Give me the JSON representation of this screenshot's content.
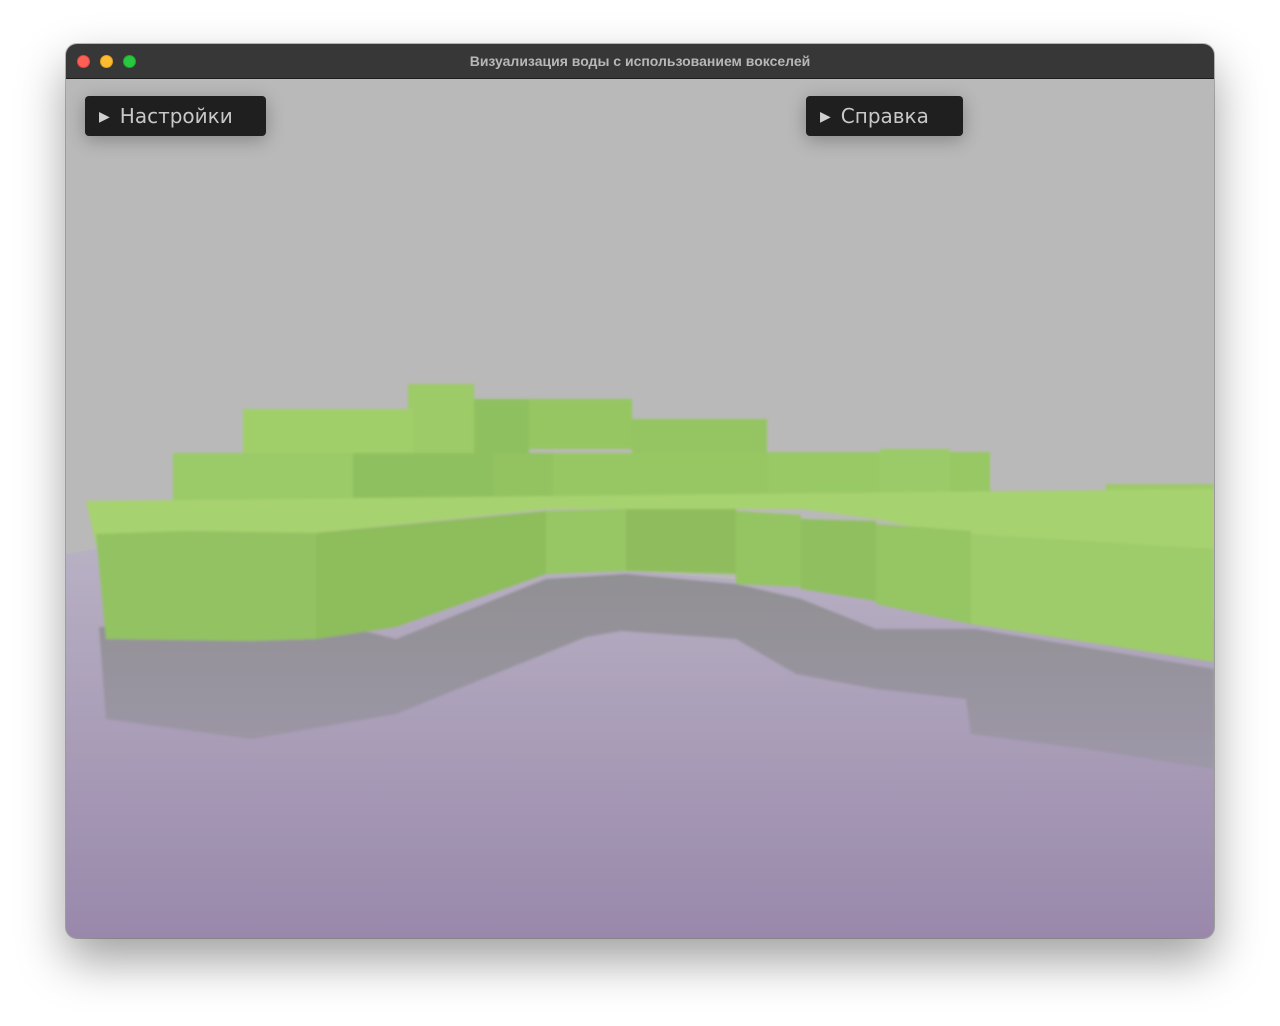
{
  "window": {
    "title": "Визуализация воды с использованием вокселей"
  },
  "overlay": {
    "settings_label": "Настройки",
    "help_label": "Справка",
    "expand_icon": "play-triangle-icon"
  },
  "colors": {
    "sky": "#b9b9b9",
    "grass": "#9ccb6a",
    "water": "#a497b4",
    "panel": "#1f1f1f",
    "titlebar": "#373737"
  }
}
